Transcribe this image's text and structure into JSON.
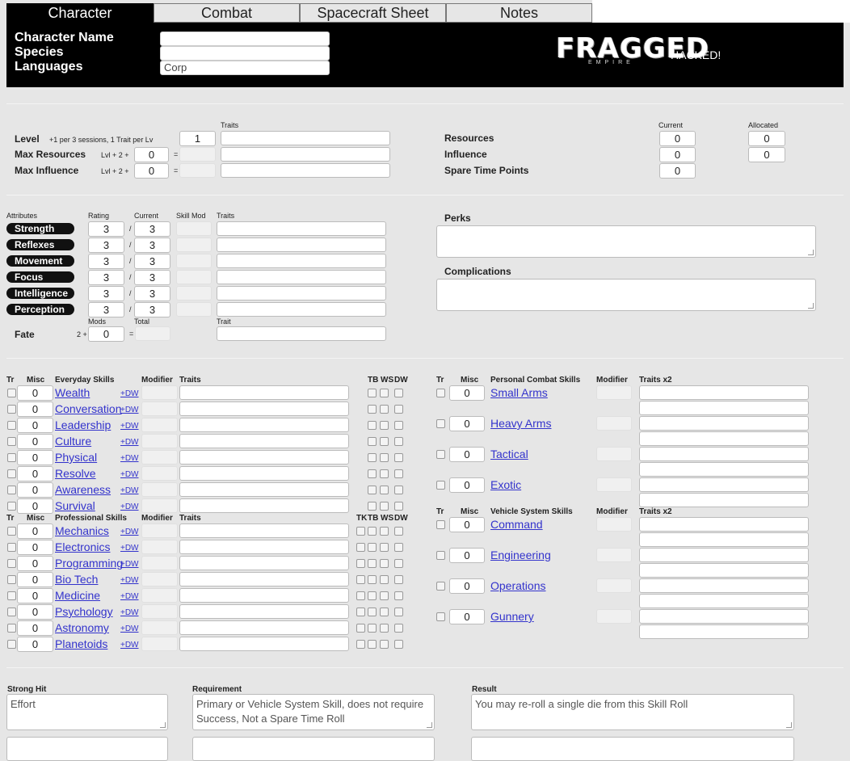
{
  "tabs": [
    "Character",
    "Combat",
    "Spacecraft Sheet",
    "Notes"
  ],
  "header": {
    "labels": [
      "Character Name",
      "Species",
      "Languages"
    ],
    "values": [
      "",
      "",
      "Corp"
    ],
    "logo": "FRAGGED",
    "logo_sub": "EMPIRE",
    "hacked": "HACKED!"
  },
  "level": {
    "level_label": "Level",
    "level_note": "+1 per 3 sessions, 1 Trait per Lv",
    "level_value": "1",
    "traits_header": "Traits",
    "max_resources_label": "Max Resources",
    "max_influence_label": "Max Influence",
    "formula": "Lvl + 2 +",
    "max_resources_mod": "0",
    "max_influence_mod": "0",
    "eq": "="
  },
  "resources": {
    "current_header": "Current",
    "allocated_header": "Allocated",
    "rows": [
      {
        "label": "Resources",
        "current": "0",
        "allocated": "0"
      },
      {
        "label": "Influence",
        "current": "0",
        "allocated": "0"
      },
      {
        "label": "Spare Time Points",
        "current": "0"
      }
    ]
  },
  "attributes": {
    "headers": [
      "Attributes",
      "Rating",
      "Current",
      "Skill Mod",
      "Traits"
    ],
    "slash": "/",
    "rows": [
      {
        "name": "Strength",
        "rating": "3",
        "current": "3"
      },
      {
        "name": "Reflexes",
        "rating": "3",
        "current": "3"
      },
      {
        "name": "Movement",
        "rating": "3",
        "current": "3"
      },
      {
        "name": "Focus",
        "rating": "3",
        "current": "3"
      },
      {
        "name": "Intelligence",
        "rating": "3",
        "current": "3"
      },
      {
        "name": "Perception",
        "rating": "3",
        "current": "3"
      }
    ],
    "fate_label": "Fate",
    "fate_prefix": "2 +",
    "fate_mods_header": "Mods",
    "fate_total_header": "Total",
    "fate_trait_header": "Trait",
    "fate_mod": "0",
    "eq": "="
  },
  "perks_label": "Perks",
  "complications_label": "Complications",
  "everyday": {
    "headers": [
      "Tr",
      "Misc",
      "Everyday Skills",
      "Modifier",
      "Traits",
      "TB",
      "WS",
      "DW"
    ],
    "skills": [
      "Wealth",
      "Conversation",
      "Leadership",
      "Culture",
      "Physical",
      "Resolve",
      "Awareness",
      "Survival"
    ],
    "misc": "0",
    "dw": "+DW"
  },
  "professional": {
    "headers": [
      "Tr",
      "Misc",
      "Professional Skills",
      "Modifier",
      "Traits",
      "TK",
      "TB",
      "WS",
      "DW"
    ],
    "skills": [
      "Mechanics",
      "Electronics",
      "Programming",
      "Bio Tech",
      "Medicine",
      "Psychology",
      "Astronomy",
      "Planetoids"
    ],
    "misc": "0",
    "dw": "+DW"
  },
  "personal_combat": {
    "headers": [
      "Tr",
      "Misc",
      "Personal Combat Skills",
      "Modifier",
      "Traits x2"
    ],
    "skills": [
      "Small Arms",
      "Heavy Arms",
      "Tactical",
      "Exotic"
    ],
    "misc": "0"
  },
  "vehicle": {
    "headers": [
      "Tr",
      "Misc",
      "Vehicle System Skills",
      "Modifier",
      "Traits x2"
    ],
    "skills": [
      "Command",
      "Engineering",
      "Operations",
      "Gunnery"
    ],
    "misc": "0"
  },
  "rolls": {
    "headers": [
      "Strong Hit",
      "Requirement",
      "Result"
    ],
    "strong_hit": "Effort",
    "requirement": "Primary or Vehicle System Skill, does not require Success, Not a Spare Time Roll",
    "result": "You may re-roll a single die from this Skill Roll"
  }
}
